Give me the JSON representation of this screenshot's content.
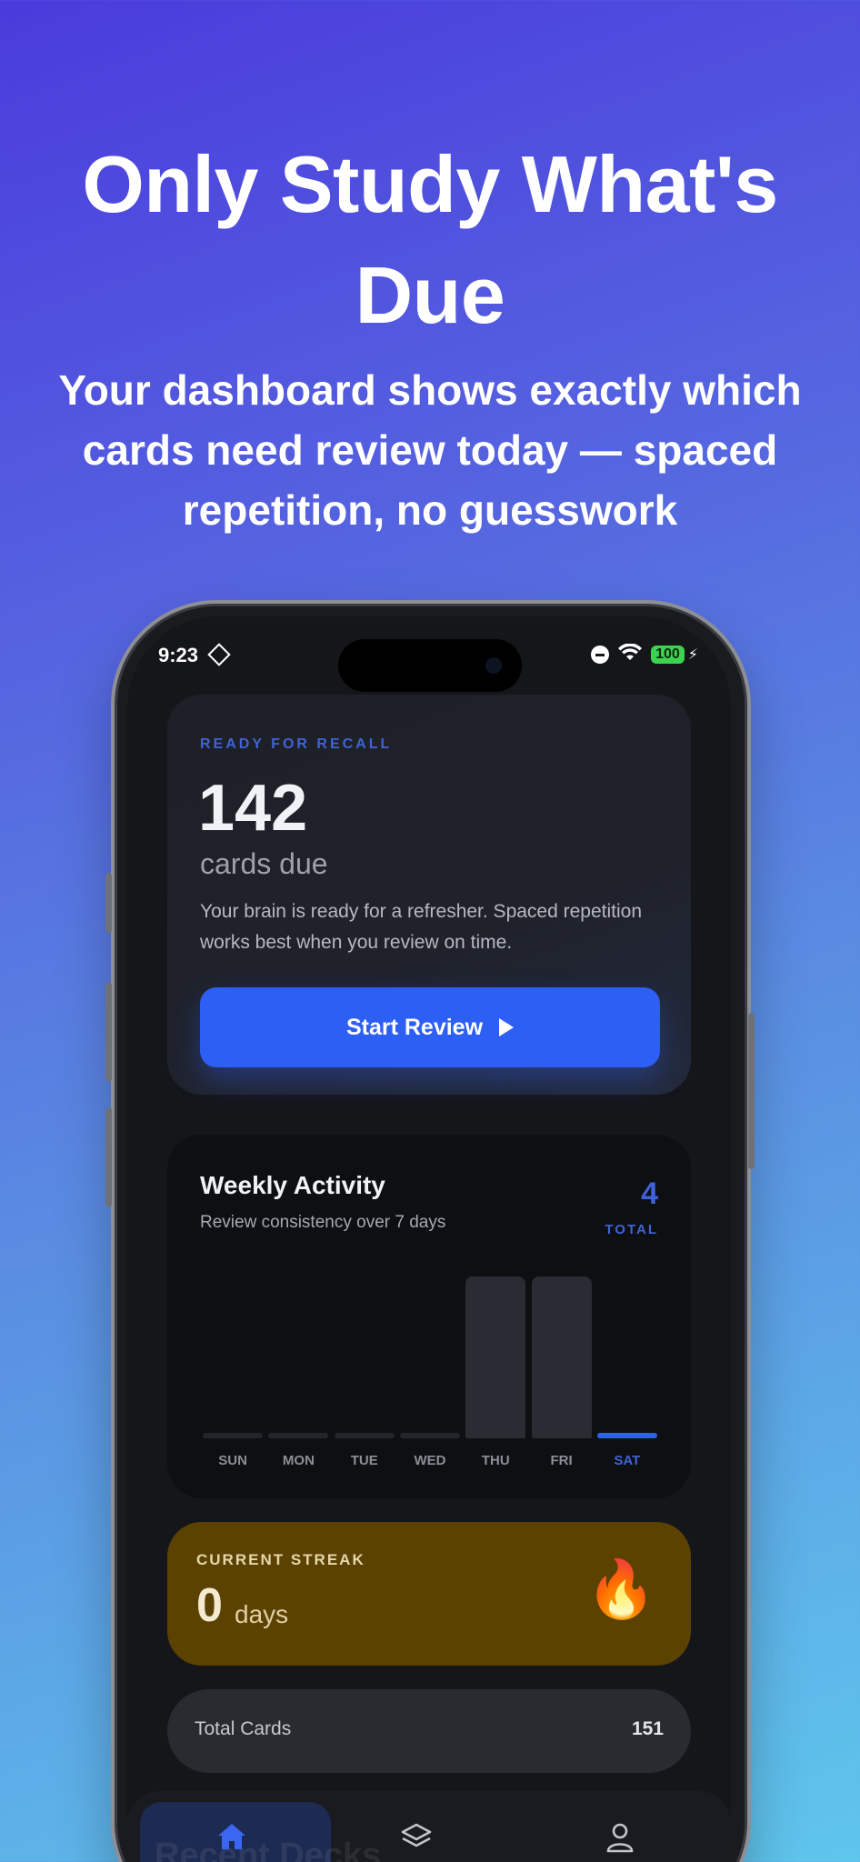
{
  "promo": {
    "headline": "Only Study What's Due",
    "subhead": "Your dashboard shows exactly which cards need review today — spaced repetition, no guesswork"
  },
  "status_bar": {
    "time": "9:23",
    "battery": "100"
  },
  "recall_card": {
    "eyebrow": "READY FOR RECALL",
    "count": "142",
    "unit": "cards due",
    "description": "Your brain is ready for a refresher. Spaced repetition works best when you review on time.",
    "button_label": "Start Review"
  },
  "weekly": {
    "title": "Weekly Activity",
    "subtitle": "Review consistency over 7 days",
    "total_value": "4",
    "total_label": "TOTAL"
  },
  "chart_data": {
    "type": "bar",
    "categories": [
      "SUN",
      "MON",
      "TUE",
      "WED",
      "THU",
      "FRI",
      "SAT"
    ],
    "values": [
      0,
      0,
      0,
      0,
      2,
      2,
      0
    ],
    "highlight": "SAT",
    "ylim": [
      0,
      2
    ],
    "title": "",
    "xlabel": "",
    "ylabel": ""
  },
  "streak": {
    "eyebrow": "CURRENT STREAK",
    "value": "0",
    "unit": "days"
  },
  "total_cards": {
    "label": "Total Cards",
    "value": "151"
  },
  "tabbar": {
    "ghost_text": "Recent Decks",
    "tabs": [
      {
        "icon": "home-icon"
      },
      {
        "icon": "layers-icon"
      },
      {
        "icon": "profile-icon"
      }
    ]
  },
  "colors": {
    "accent": "#2e5ff5",
    "accent_text": "#3f62d8",
    "streak_bg": "#5c4200"
  }
}
